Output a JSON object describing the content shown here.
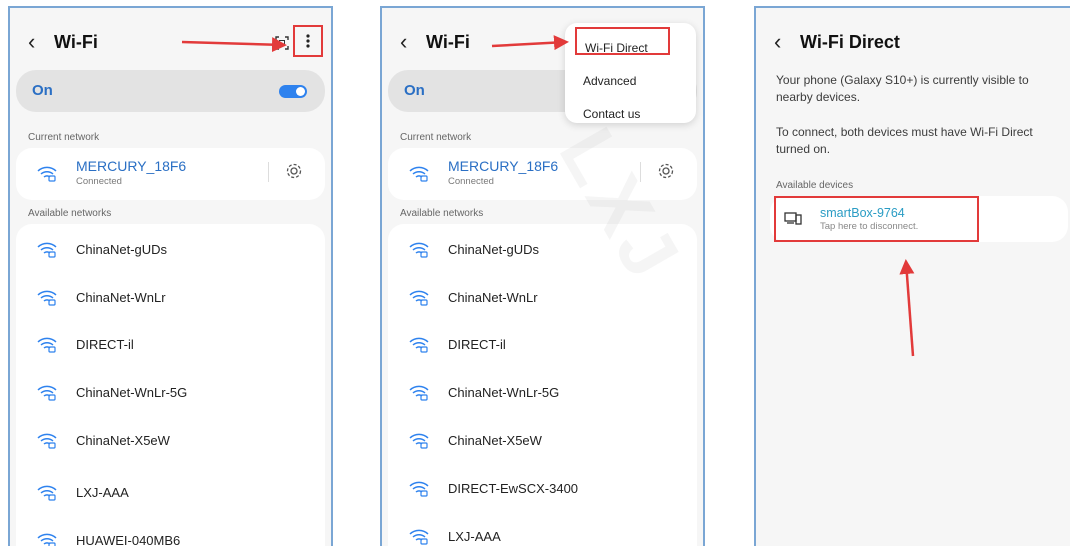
{
  "colors": {
    "accent": "#2a6fc4",
    "annotation_red": "#e23a3a",
    "frame_blue": "#7aa6d4"
  },
  "screen1": {
    "back_icon": "chevron-left-icon",
    "title": "Wi-Fi",
    "qr_icon": "qr-scan-icon",
    "more_icon": "more-vertical-icon",
    "toggle_label": "On",
    "toggle_on": true,
    "current_network_label": "Current network",
    "current_network": {
      "name": "MERCURY_18F6",
      "status": "Connected"
    },
    "available_networks_label": "Available networks",
    "networks": [
      "ChinaNet-gUDs",
      "ChinaNet-WnLr",
      "DIRECT-il",
      "ChinaNet-WnLr-5G",
      "ChinaNet-X5eW",
      "LXJ-AAA",
      "HUAWEI-040MB6"
    ]
  },
  "screen2": {
    "title": "Wi-Fi",
    "toggle_label": "On",
    "menu": [
      "Wi-Fi Direct",
      "Advanced",
      "Contact us"
    ],
    "current_network_label": "Current network",
    "current_network": {
      "name": "MERCURY_18F6",
      "status": "Connected"
    },
    "available_networks_label": "Available networks",
    "networks": [
      "ChinaNet-gUDs",
      "ChinaNet-WnLr",
      "DIRECT-il",
      "ChinaNet-WnLr-5G",
      "ChinaNet-X5eW",
      "DIRECT-EwSCX-3400",
      "LXJ-AAA"
    ]
  },
  "screen3": {
    "title": "Wi-Fi Direct",
    "visible_text": "Your phone (Galaxy S10+) is currently visible to nearby devices.",
    "connect_text": "To connect, both devices must have Wi-Fi Direct turned on.",
    "available_devices_label": "Available devices",
    "device": {
      "name": "smartBox-9764",
      "subtitle": "Tap here to disconnect.",
      "icon": "devices-icon"
    }
  }
}
